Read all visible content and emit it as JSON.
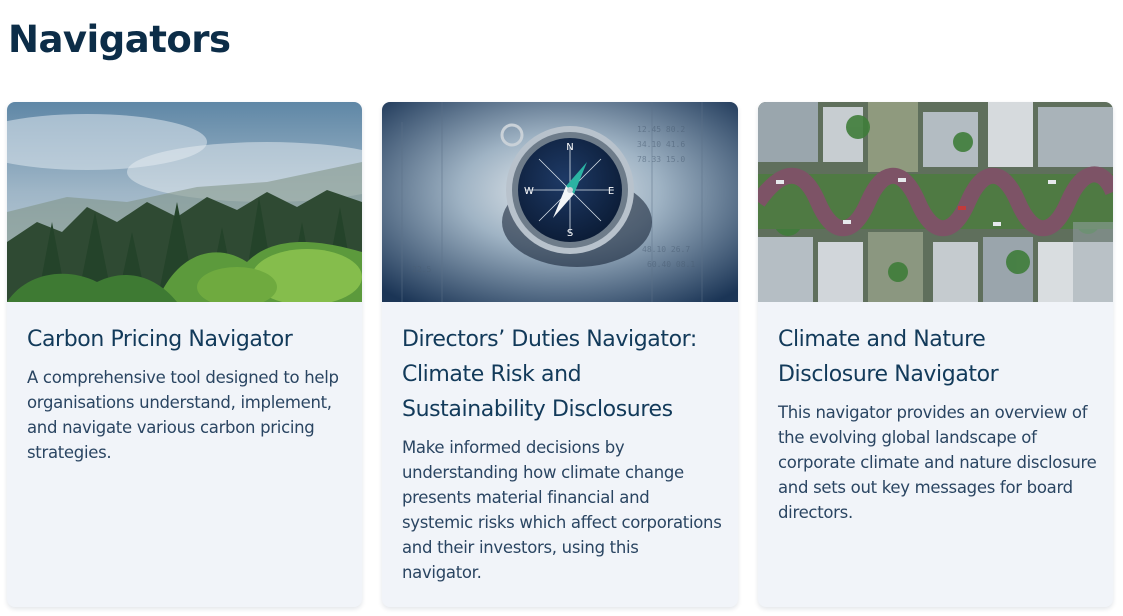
{
  "page": {
    "title": "Navigators"
  },
  "cards": [
    {
      "title": "Carbon Pricing Navigator",
      "description": "A comprehensive tool designed to help organisations understand, implement, and navigate various carbon pricing strategies.",
      "image_icon": "misty-forest-image"
    },
    {
      "title": "Directors’ Duties Navigator: Climate Risk and Sustainability Disclosures",
      "description": "Make informed decisions by understanding how climate change presents material financial and systemic risks which affect corporations and their investors, using this navigator.",
      "image_icon": "compass-on-stock-listings-image"
    },
    {
      "title": "Climate and Nature Disclosure Navigator",
      "description": "This navigator provides an overview of the evolving global landscape of corporate climate and nature disclosure and sets out key messages for board directors.",
      "image_icon": "aerial-winding-street-image"
    }
  ],
  "colors": {
    "title": "#0c2d48",
    "card_bg": "#f1f4f9",
    "text": "#2a4562"
  }
}
